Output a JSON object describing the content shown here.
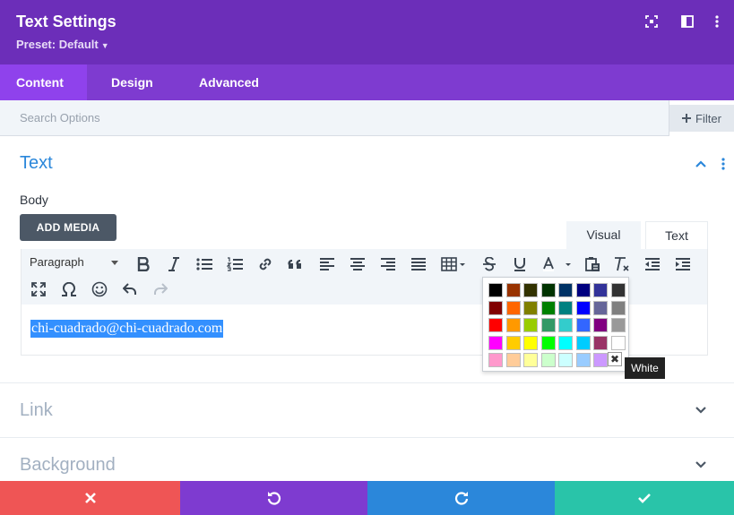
{
  "header": {
    "title": "Text Settings",
    "preset": "Preset: Default",
    "icons": [
      "focus-icon",
      "sidebar-layout-icon",
      "more-vertical-icon"
    ]
  },
  "tabs": [
    {
      "label": "Content",
      "active": true
    },
    {
      "label": "Design",
      "active": false
    },
    {
      "label": "Advanced",
      "active": false
    }
  ],
  "search": {
    "placeholder": "Search Options",
    "value": ""
  },
  "filter": {
    "label": "Filter"
  },
  "sections": {
    "text": {
      "title": "Text",
      "expanded": true
    },
    "link": {
      "title": "Link",
      "expanded": false
    },
    "background": {
      "title": "Background",
      "expanded": false
    }
  },
  "body_label": "Body",
  "add_media_label": "ADD MEDIA",
  "editor_tabs": {
    "visual": "Visual",
    "text": "Text"
  },
  "toolbar": {
    "format_select": "Paragraph"
  },
  "editor": {
    "content": "chi-cuadrado@chi-cuadrado.com"
  },
  "color_picker": {
    "colors": [
      [
        "#000000",
        "#993300",
        "#333300",
        "#003300",
        "#003366",
        "#000080",
        "#333399",
        "#333333"
      ],
      [
        "#800000",
        "#ff6600",
        "#808000",
        "#008000",
        "#008080",
        "#0000ff",
        "#666699",
        "#808080"
      ],
      [
        "#ff0000",
        "#ff9900",
        "#99cc00",
        "#339966",
        "#33cccc",
        "#3366ff",
        "#800080",
        "#999999"
      ],
      [
        "#ff00ff",
        "#ffcc00",
        "#ffff00",
        "#00ff00",
        "#00ffff",
        "#00ccff",
        "#993366",
        "#ffffff"
      ],
      [
        "#ff99cc",
        "#ffcc99",
        "#ffff99",
        "#ccffcc",
        "#ccffff",
        "#99ccff",
        "#cc99ff"
      ]
    ],
    "tooltip": "White"
  },
  "footer": {
    "buttons": [
      {
        "name": "discard",
        "color": "#ef5555"
      },
      {
        "name": "undo",
        "color": "#7e3bd0"
      },
      {
        "name": "redo",
        "color": "#2b87da"
      },
      {
        "name": "save",
        "color": "#29c4a9"
      }
    ]
  },
  "colors": {
    "header": "#6c2eb9",
    "tabs": "#7e3bd0",
    "active_tab": "#8f42ec",
    "section_title": "#2b87da",
    "section_title_muted": "#a2b0c1"
  }
}
